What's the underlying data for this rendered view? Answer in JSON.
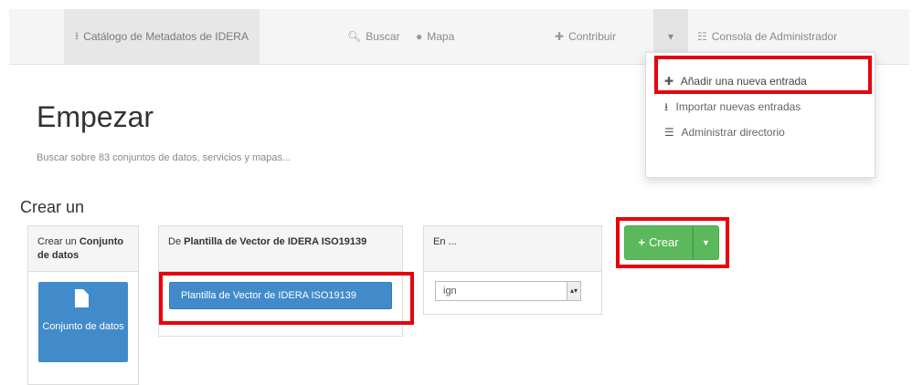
{
  "navbar": {
    "brand": {
      "label": "Catálogo de Metadatos de IDERA",
      "icon": "upload-icon"
    },
    "items": [
      {
        "label": "Buscar",
        "icon": "search-icon"
      },
      {
        "label": "Mapa",
        "icon": "globe-icon"
      },
      {
        "label": "Contribuir",
        "icon": "plus-icon"
      }
    ],
    "caret_icon": "caret-down-icon",
    "admin": {
      "label": "Consola de Administrador",
      "icon": "grid-icon"
    }
  },
  "dropdown": {
    "items": [
      {
        "label": "Añadir una nueva entrada",
        "icon": "plus-icon"
      },
      {
        "label": "Importar nuevas entradas",
        "icon": "upload-icon"
      },
      {
        "label": "Administrar directorio",
        "icon": "list-icon"
      }
    ]
  },
  "page": {
    "title": "Empezar",
    "subtitle": "Buscar sobre 83 conjuntos de datos, servicios y mapas...",
    "section_title": "Crear un"
  },
  "panel_type": {
    "head_prefix": "Crear un ",
    "head_bold": "Conjunto de datos",
    "tile_label": "Conjunto de datos",
    "tile_icon": "document-icon"
  },
  "panel_template": {
    "head_prefix": "De ",
    "head_bold": "Plantilla de Vector de IDERA ISO19139",
    "button_label": "Plantilla de Vector de IDERA ISO19139"
  },
  "panel_group": {
    "head": "En ...",
    "selected": "ign"
  },
  "create": {
    "label": "Crear",
    "icon": "plus-icon"
  },
  "colors": {
    "highlight": "#e8000b",
    "primary": "#428bca",
    "success": "#5cb85c"
  }
}
